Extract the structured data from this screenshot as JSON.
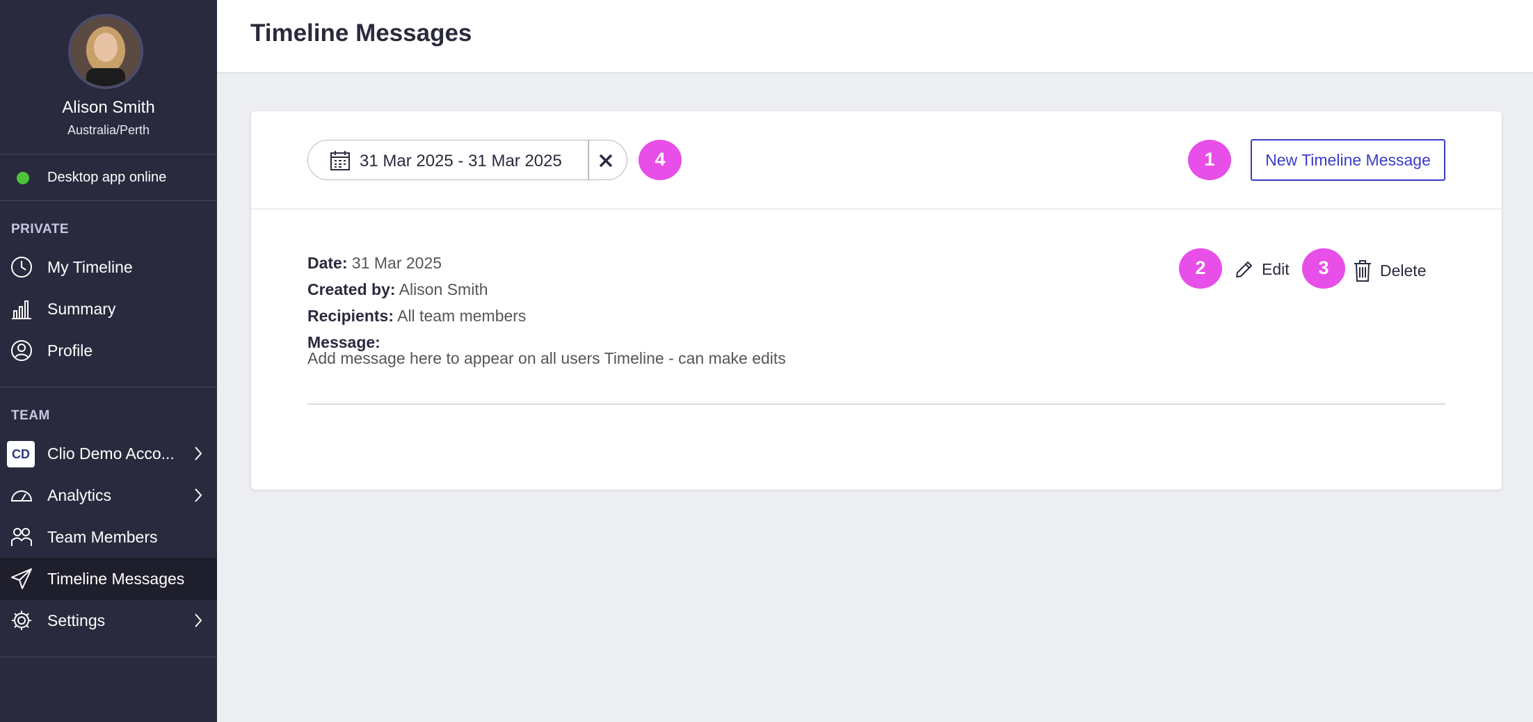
{
  "user": {
    "name": "Alison Smith",
    "timezone": "Australia/Perth"
  },
  "status": {
    "text": "Desktop app online",
    "color": "#4cc33b"
  },
  "sidebar": {
    "private_label": "PRIVATE",
    "private_items": [
      {
        "label": "My Timeline",
        "icon": "clock-icon"
      },
      {
        "label": "Summary",
        "icon": "bar-chart-icon"
      },
      {
        "label": "Profile",
        "icon": "user-circle-icon"
      }
    ],
    "team_label": "TEAM",
    "team_items": [
      {
        "label": "Clio Demo Acco...",
        "badge": "CD"
      },
      {
        "label": "Analytics",
        "icon": "gauge-icon"
      },
      {
        "label": "Team Members",
        "icon": "people-icon"
      },
      {
        "label": "Timeline Messages",
        "icon": "send-icon",
        "active": true
      },
      {
        "label": "Settings",
        "icon": "gear-icon"
      }
    ]
  },
  "header": {
    "title": "Timeline Messages"
  },
  "toolbar": {
    "date_range": "31 Mar 2025 - 31 Mar 2025",
    "new_button": "New Timeline Message",
    "badges": [
      "1",
      "2",
      "3",
      "4"
    ]
  },
  "message": {
    "date_label": "Date:",
    "date": "31 Mar 2025",
    "created_label": "Created by:",
    "created_by": "Alison Smith",
    "recipients_label": "Recipients:",
    "recipients": "All team members",
    "message_label": "Message:",
    "body": "Add message here to appear on all users Timeline - can make edits",
    "edit_label": "Edit",
    "delete_label": "Delete"
  },
  "colors": {
    "accent": "#3b3bc6",
    "badge": "#e84ee8",
    "sidebar": "#2a2a3e"
  }
}
